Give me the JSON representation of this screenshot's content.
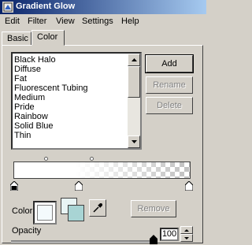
{
  "window": {
    "title": "Gradient Glow"
  },
  "menu": [
    "Edit",
    "Filter",
    "View",
    "Settings",
    "Help"
  ],
  "tabs": [
    {
      "label": "Basic",
      "active": false
    },
    {
      "label": "Color",
      "active": true
    }
  ],
  "presets": {
    "items": [
      "Black Halo",
      "Diffuse",
      "Fat",
      "Fluorescent Tubing",
      "Medium",
      "Pride",
      "Rainbow",
      "Solid Blue",
      "Thin"
    ]
  },
  "buttons": {
    "add": "Add",
    "rename": "Rename",
    "delete": "Delete",
    "remove": "Remove"
  },
  "color": {
    "label": "Color",
    "current": "#f4fafc",
    "recent": [
      "#e8f4f4",
      "#a8d4d4"
    ]
  },
  "opacity": {
    "label": "Opacity",
    "value": "100"
  }
}
